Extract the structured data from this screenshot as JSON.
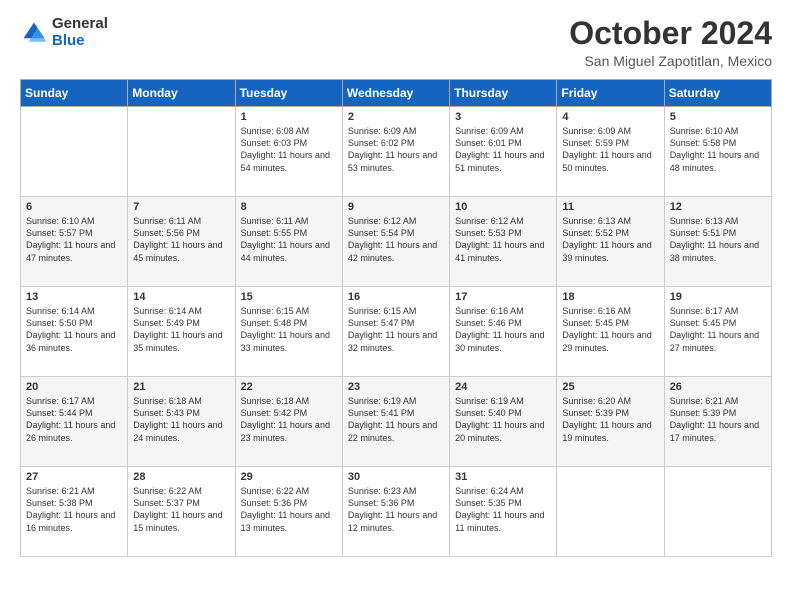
{
  "logo": {
    "general": "General",
    "blue": "Blue"
  },
  "header": {
    "month_title": "October 2024",
    "location": "San Miguel Zapotitlan, Mexico"
  },
  "days_of_week": [
    "Sunday",
    "Monday",
    "Tuesday",
    "Wednesday",
    "Thursday",
    "Friday",
    "Saturday"
  ],
  "weeks": [
    [
      {
        "day": "",
        "content": ""
      },
      {
        "day": "",
        "content": ""
      },
      {
        "day": "1",
        "content": "Sunrise: 6:08 AM\nSunset: 6:03 PM\nDaylight: 11 hours and 54 minutes."
      },
      {
        "day": "2",
        "content": "Sunrise: 6:09 AM\nSunset: 6:02 PM\nDaylight: 11 hours and 53 minutes."
      },
      {
        "day": "3",
        "content": "Sunrise: 6:09 AM\nSunset: 6:01 PM\nDaylight: 11 hours and 51 minutes."
      },
      {
        "day": "4",
        "content": "Sunrise: 6:09 AM\nSunset: 5:59 PM\nDaylight: 11 hours and 50 minutes."
      },
      {
        "day": "5",
        "content": "Sunrise: 6:10 AM\nSunset: 5:58 PM\nDaylight: 11 hours and 48 minutes."
      }
    ],
    [
      {
        "day": "6",
        "content": "Sunrise: 6:10 AM\nSunset: 5:57 PM\nDaylight: 11 hours and 47 minutes."
      },
      {
        "day": "7",
        "content": "Sunrise: 6:11 AM\nSunset: 5:56 PM\nDaylight: 11 hours and 45 minutes."
      },
      {
        "day": "8",
        "content": "Sunrise: 6:11 AM\nSunset: 5:55 PM\nDaylight: 11 hours and 44 minutes."
      },
      {
        "day": "9",
        "content": "Sunrise: 6:12 AM\nSunset: 5:54 PM\nDaylight: 11 hours and 42 minutes."
      },
      {
        "day": "10",
        "content": "Sunrise: 6:12 AM\nSunset: 5:53 PM\nDaylight: 11 hours and 41 minutes."
      },
      {
        "day": "11",
        "content": "Sunrise: 6:13 AM\nSunset: 5:52 PM\nDaylight: 11 hours and 39 minutes."
      },
      {
        "day": "12",
        "content": "Sunrise: 6:13 AM\nSunset: 5:51 PM\nDaylight: 11 hours and 38 minutes."
      }
    ],
    [
      {
        "day": "13",
        "content": "Sunrise: 6:14 AM\nSunset: 5:50 PM\nDaylight: 11 hours and 36 minutes."
      },
      {
        "day": "14",
        "content": "Sunrise: 6:14 AM\nSunset: 5:49 PM\nDaylight: 11 hours and 35 minutes."
      },
      {
        "day": "15",
        "content": "Sunrise: 6:15 AM\nSunset: 5:48 PM\nDaylight: 11 hours and 33 minutes."
      },
      {
        "day": "16",
        "content": "Sunrise: 6:15 AM\nSunset: 5:47 PM\nDaylight: 11 hours and 32 minutes."
      },
      {
        "day": "17",
        "content": "Sunrise: 6:16 AM\nSunset: 5:46 PM\nDaylight: 11 hours and 30 minutes."
      },
      {
        "day": "18",
        "content": "Sunrise: 6:16 AM\nSunset: 5:45 PM\nDaylight: 11 hours and 29 minutes."
      },
      {
        "day": "19",
        "content": "Sunrise: 6:17 AM\nSunset: 5:45 PM\nDaylight: 11 hours and 27 minutes."
      }
    ],
    [
      {
        "day": "20",
        "content": "Sunrise: 6:17 AM\nSunset: 5:44 PM\nDaylight: 11 hours and 26 minutes."
      },
      {
        "day": "21",
        "content": "Sunrise: 6:18 AM\nSunset: 5:43 PM\nDaylight: 11 hours and 24 minutes."
      },
      {
        "day": "22",
        "content": "Sunrise: 6:18 AM\nSunset: 5:42 PM\nDaylight: 11 hours and 23 minutes."
      },
      {
        "day": "23",
        "content": "Sunrise: 6:19 AM\nSunset: 5:41 PM\nDaylight: 11 hours and 22 minutes."
      },
      {
        "day": "24",
        "content": "Sunrise: 6:19 AM\nSunset: 5:40 PM\nDaylight: 11 hours and 20 minutes."
      },
      {
        "day": "25",
        "content": "Sunrise: 6:20 AM\nSunset: 5:39 PM\nDaylight: 11 hours and 19 minutes."
      },
      {
        "day": "26",
        "content": "Sunrise: 6:21 AM\nSunset: 5:39 PM\nDaylight: 11 hours and 17 minutes."
      }
    ],
    [
      {
        "day": "27",
        "content": "Sunrise: 6:21 AM\nSunset: 5:38 PM\nDaylight: 11 hours and 16 minutes."
      },
      {
        "day": "28",
        "content": "Sunrise: 6:22 AM\nSunset: 5:37 PM\nDaylight: 11 hours and 15 minutes."
      },
      {
        "day": "29",
        "content": "Sunrise: 6:22 AM\nSunset: 5:36 PM\nDaylight: 11 hours and 13 minutes."
      },
      {
        "day": "30",
        "content": "Sunrise: 6:23 AM\nSunset: 5:36 PM\nDaylight: 11 hours and 12 minutes."
      },
      {
        "day": "31",
        "content": "Sunrise: 6:24 AM\nSunset: 5:35 PM\nDaylight: 11 hours and 11 minutes."
      },
      {
        "day": "",
        "content": ""
      },
      {
        "day": "",
        "content": ""
      }
    ]
  ]
}
